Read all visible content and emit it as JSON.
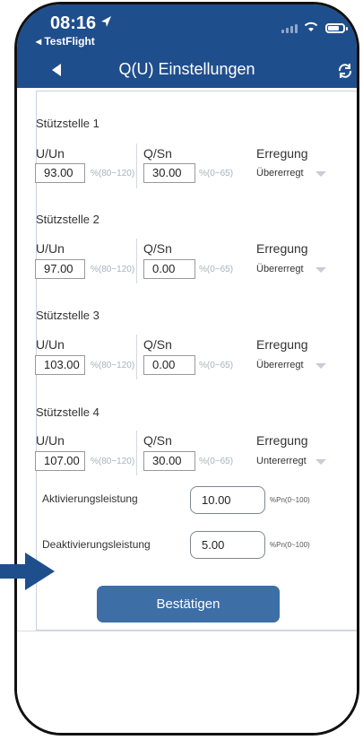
{
  "status": {
    "time": "08:16",
    "back_app": "◂ TestFlight"
  },
  "nav": {
    "title": "Q(U) Einstellungen"
  },
  "sections": [
    {
      "title": "Stützstelle 1",
      "u_label": "U/Un",
      "q_label": "Q/Sn",
      "e_label": "Erregung",
      "u_value": "93.00",
      "u_hint": "%(80~120)",
      "q_value": "30.00",
      "q_hint": "%(0~65)",
      "e_value": "Übererregt"
    },
    {
      "title": "Stützstelle 2",
      "u_label": "U/Un",
      "q_label": "Q/Sn",
      "e_label": "Erregung",
      "u_value": "97.00",
      "u_hint": "%(80~120)",
      "q_value": "0.00",
      "q_hint": "%(0~65)",
      "e_value": "Übererregt"
    },
    {
      "title": "Stützstelle 3",
      "u_label": "U/Un",
      "q_label": "Q/Sn",
      "e_label": "Erregung",
      "u_value": "103.00",
      "u_hint": "%(80~120)",
      "q_value": "0.00",
      "q_hint": "%(0~65)",
      "e_value": "Übererregt"
    },
    {
      "title": "Stützstelle 4",
      "u_label": "U/Un",
      "q_label": "Q/Sn",
      "e_label": "Erregung",
      "u_value": "107.00",
      "u_hint": "%(80~120)",
      "q_value": "30.00",
      "q_hint": "%(0~65)",
      "e_value": "Untererregt"
    }
  ],
  "activation": {
    "label": "Aktivierungsleistung",
    "value": "10.00",
    "unit": "%Pn(0~100)"
  },
  "deactivation": {
    "label": "Deaktivierungsleistung",
    "value": "5.00",
    "unit": "%Pn(0~100)"
  },
  "confirm": {
    "label": "Bestätigen"
  },
  "colors": {
    "header": "#1f4e8c",
    "button": "#3d6ea6",
    "arrow": "#1f4e8c"
  },
  "icons": {
    "back": "back-arrow-icon",
    "refresh": "refresh-icon",
    "location": "location-arrow-icon",
    "wifi": "wifi-icon",
    "battery": "battery-icon",
    "pointer": "pointer-arrow-icon"
  }
}
